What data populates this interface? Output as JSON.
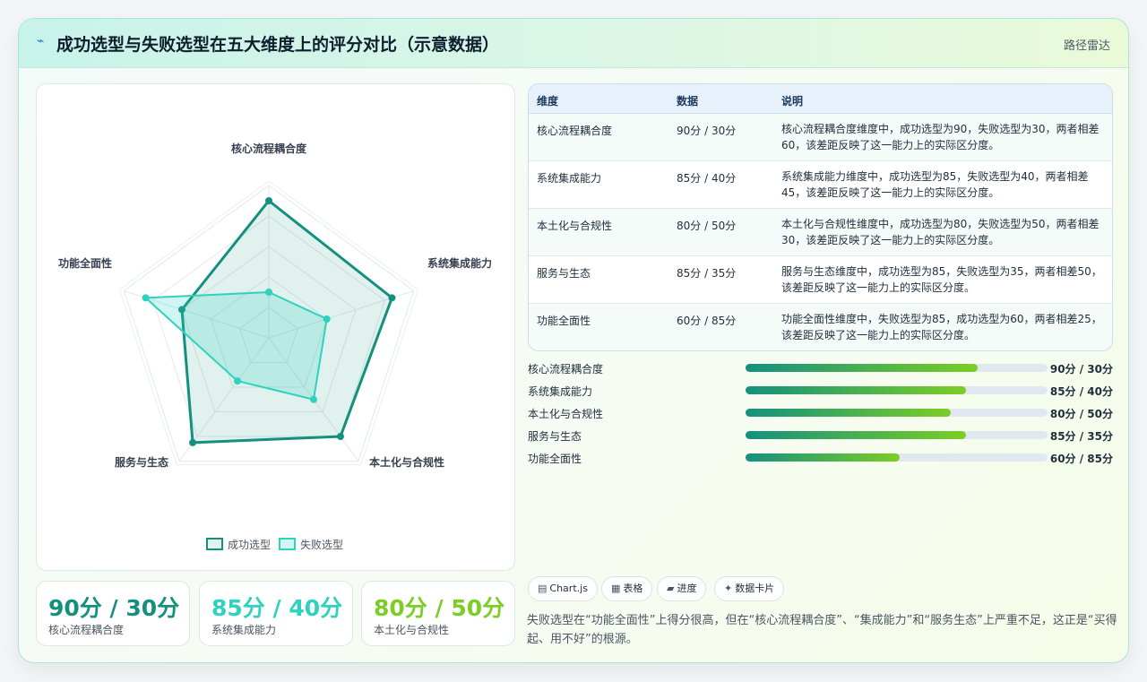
{
  "header": {
    "icon": "lightning-icon",
    "title": "成功选型与失败选型在五大维度上的评分对比（示意数据）",
    "badge": "路径雷达"
  },
  "chart_data": {
    "type": "radar",
    "categories": [
      "核心流程耦合度",
      "系统集成能力",
      "本土化与合规性",
      "服务与生态",
      "功能全面性"
    ],
    "series": [
      {
        "name": "成功选型",
        "values": [
          90,
          85,
          80,
          85,
          60
        ],
        "color": "#14907f"
      },
      {
        "name": "失败选型",
        "values": [
          30,
          40,
          50,
          35,
          85
        ],
        "color": "#2fd1bf"
      }
    ],
    "range": [
      0,
      100
    ],
    "grid_levels": 5,
    "legend_position": "bottom"
  },
  "stats": [
    {
      "value": "90分 / 30分",
      "label": "核心流程耦合度",
      "color": "#14907f"
    },
    {
      "value": "85分 / 40分",
      "label": "系统集成能力",
      "color": "#2fd1bf"
    },
    {
      "value": "80分 / 50分",
      "label": "本土化与合规性",
      "color": "#7ccd25"
    }
  ],
  "table": {
    "headers": [
      "维度",
      "数据",
      "说明"
    ],
    "rows": [
      {
        "dim": "核心流程耦合度",
        "data": "90分 / 30分",
        "desc": "核心流程耦合度维度中，成功选型为90，失败选型为30，两者相差60，该差距反映了这一能力上的实际区分度。"
      },
      {
        "dim": "系统集成能力",
        "data": "85分 / 40分",
        "desc": "系统集成能力维度中，成功选型为85，失败选型为40，两者相差45，该差距反映了这一能力上的实际区分度。"
      },
      {
        "dim": "本土化与合规性",
        "data": "80分 / 50分",
        "desc": "本土化与合规性维度中，成功选型为80，失败选型为50，两者相差30，该差距反映了这一能力上的实际区分度。"
      },
      {
        "dim": "服务与生态",
        "data": "85分 / 35分",
        "desc": "服务与生态维度中，成功选型为85，失败选型为35，两者相差50，该差距反映了这一能力上的实际区分度。"
      },
      {
        "dim": "功能全面性",
        "data": "60分 / 85分",
        "desc": "功能全面性维度中，失败选型为85，成功选型为60，两者相差25，该差距反映了这一能力上的实际区分度。"
      }
    ]
  },
  "progress": [
    {
      "label": "核心流程耦合度",
      "fraction": 0.77,
      "value": "90分 / 30分"
    },
    {
      "label": "系统集成能力",
      "fraction": 0.73,
      "value": "85分 / 40分"
    },
    {
      "label": "本土化与合规性",
      "fraction": 0.68,
      "value": "80分 / 50分"
    },
    {
      "label": "服务与生态",
      "fraction": 0.73,
      "value": "85分 / 35分"
    },
    {
      "label": "功能全面性",
      "fraction": 0.51,
      "value": "60分 / 85分"
    }
  ],
  "tags": [
    {
      "icon": "chart-icon",
      "glyph": "▤",
      "label": "Chart.js"
    },
    {
      "icon": "table-icon",
      "glyph": "▦",
      "label": "表格"
    },
    {
      "icon": "progress-icon",
      "glyph": "▰",
      "label": "进度"
    },
    {
      "icon": "sparkle-icon",
      "glyph": "✦",
      "label": "数据卡片"
    }
  ],
  "note": "失败选型在“功能全面性”上得分很高，但在“核心流程耦合度”、“集成能力”和“服务生态”上严重不足，这正是“买得起、用不好”的根源。"
}
